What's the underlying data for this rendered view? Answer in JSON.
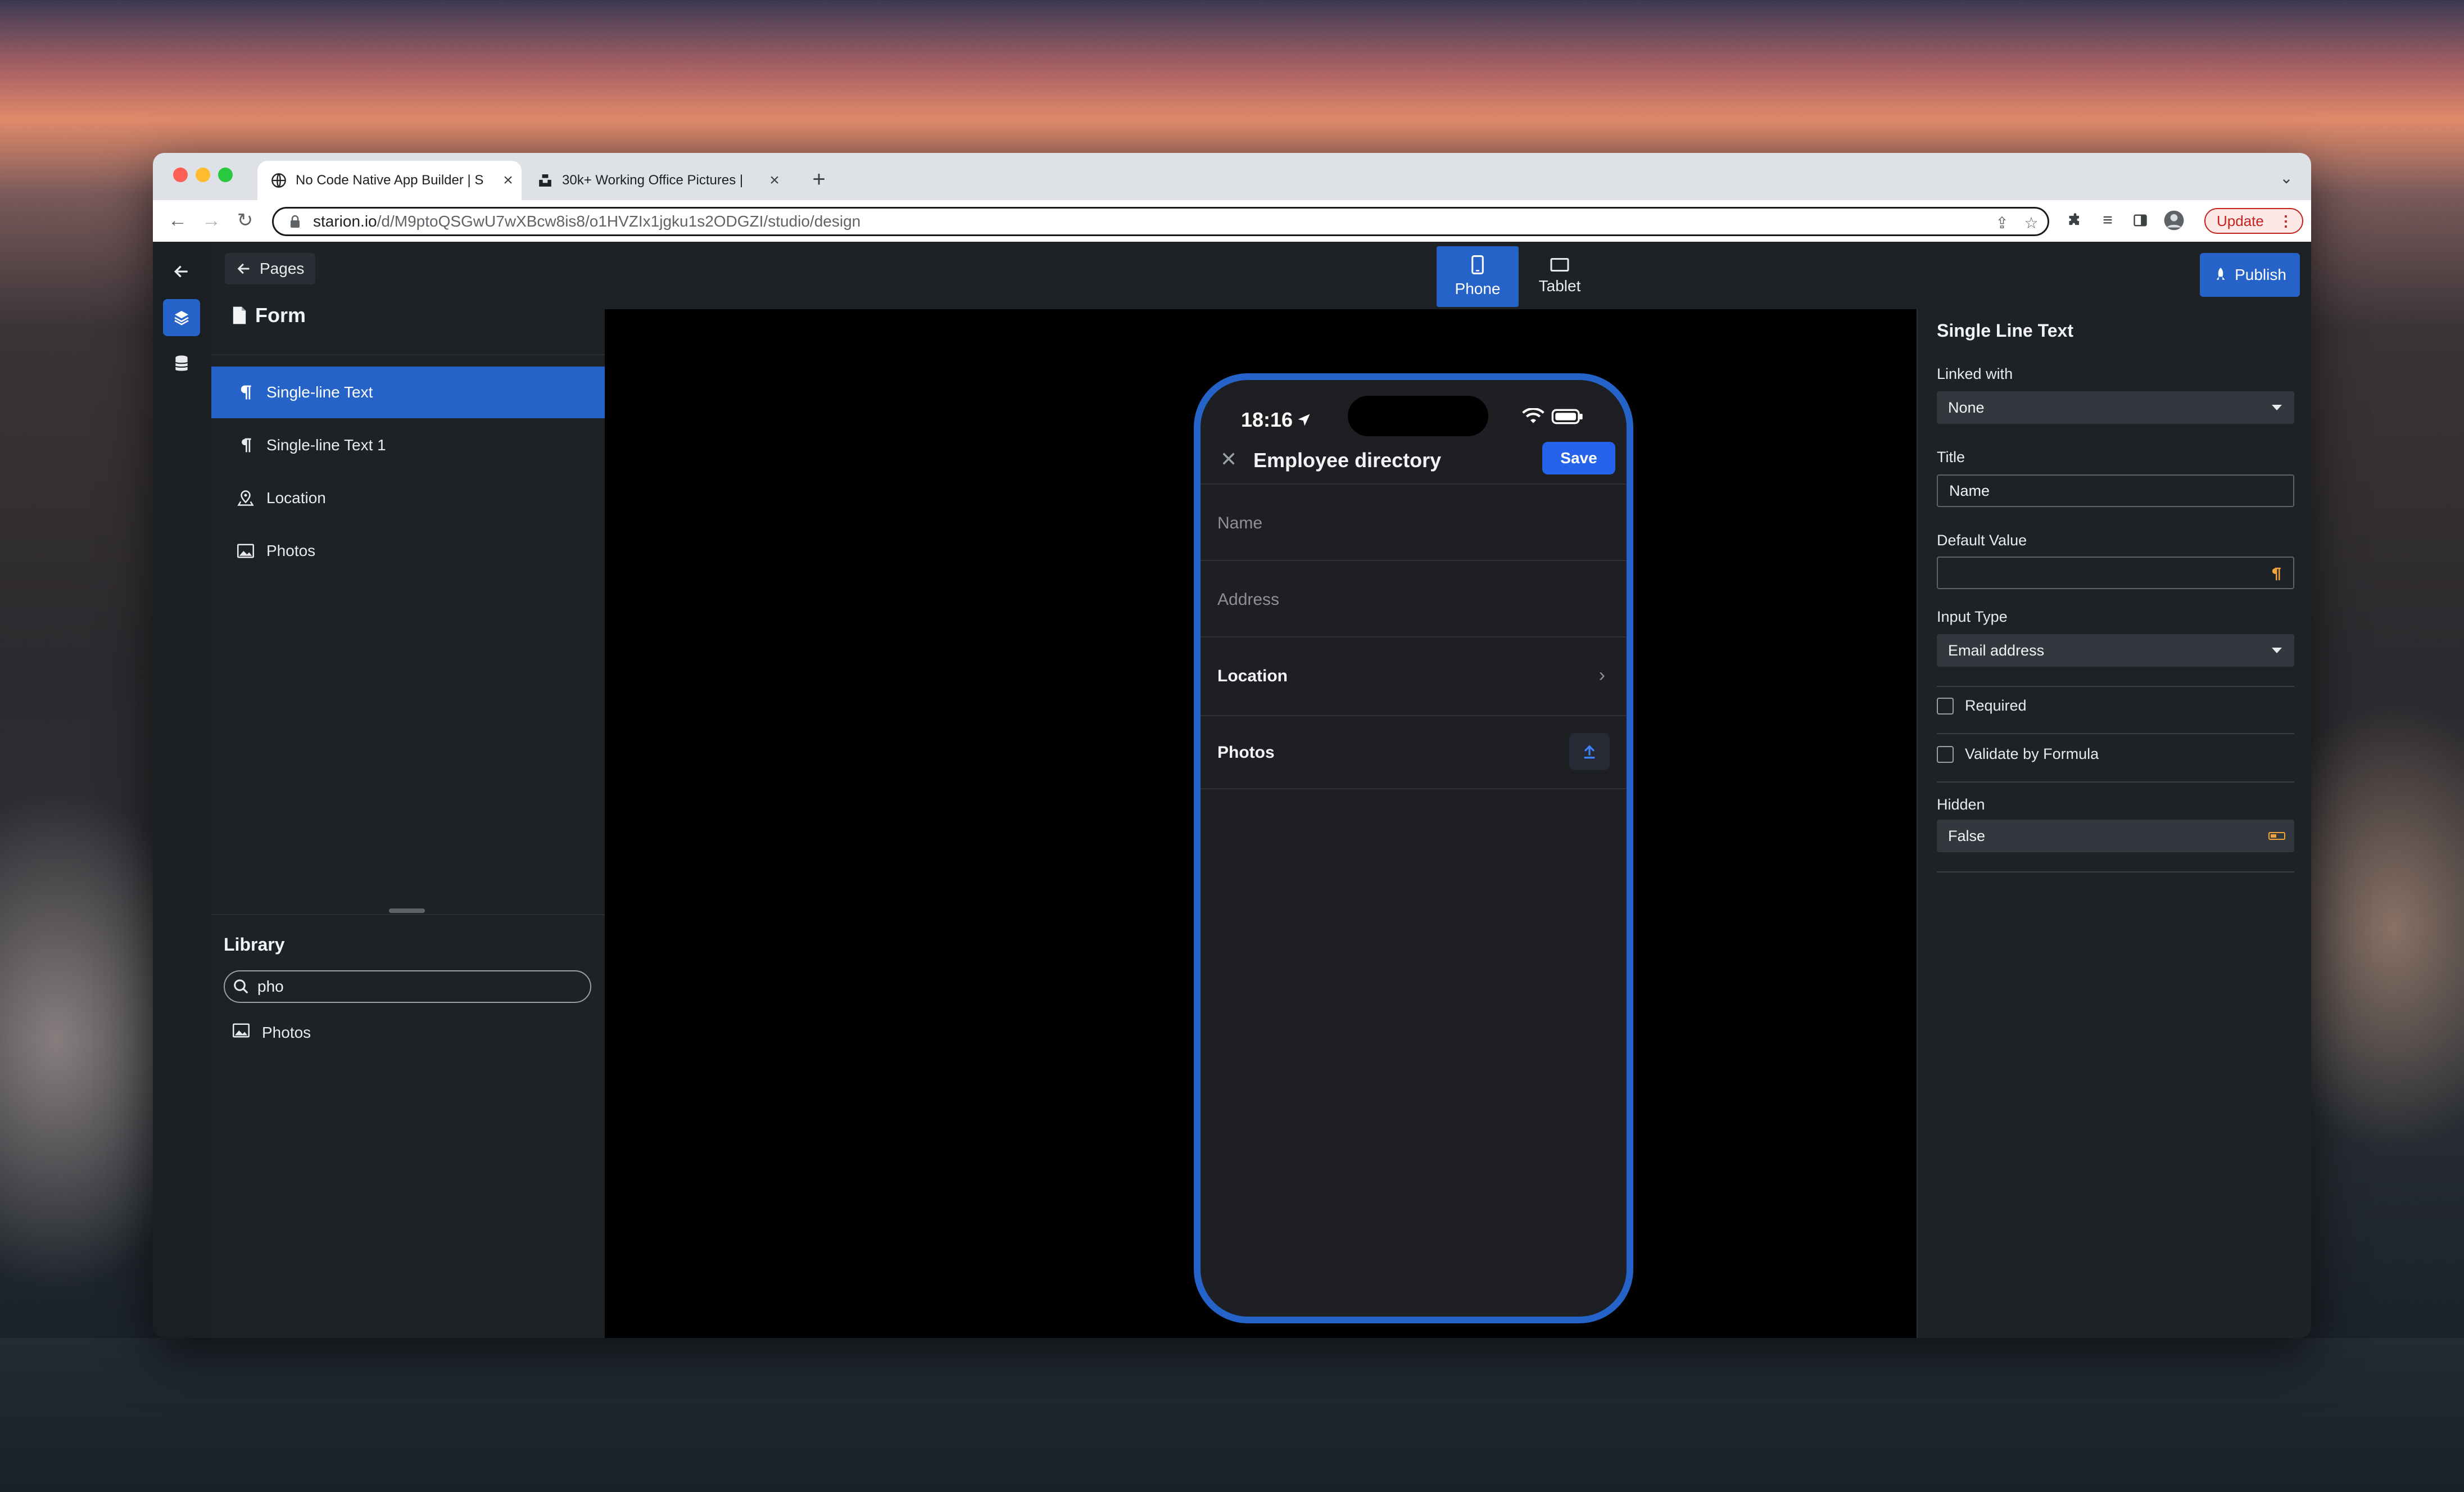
{
  "browser": {
    "tabs": [
      {
        "title": "No Code Native App Builder | S",
        "icon": "globe-icon",
        "active": true
      },
      {
        "title": "30k+ Working Office Pictures | ",
        "icon": "unsplash-icon",
        "active": false
      }
    ],
    "url_host": "starion.io",
    "url_path": "/d/M9ptoQSGwU7wXBcw8is8/o1HVZIx1jgku1s2ODGZI/studio/design",
    "update_label": "Update",
    "colors": {
      "update": "#c5221f",
      "accent": "#2563c9"
    }
  },
  "left_panel": {
    "pages_button": "Pages",
    "form_title": "Form",
    "items": [
      {
        "label": "Single-line Text",
        "icon": "paragraph-icon",
        "selected": true
      },
      {
        "label": "Single-line Text 1",
        "icon": "paragraph-icon",
        "selected": false
      },
      {
        "label": "Location",
        "icon": "location-pin-icon",
        "selected": false
      },
      {
        "label": "Photos",
        "icon": "image-icon",
        "selected": false
      }
    ],
    "library": {
      "title": "Library",
      "search_value": "pho",
      "results": [
        {
          "label": "Photos",
          "icon": "image-icon"
        }
      ]
    }
  },
  "device_switcher": {
    "options": [
      {
        "label": "Phone",
        "icon": "phone-icon",
        "active": true
      },
      {
        "label": "Tablet",
        "icon": "tablet-icon",
        "active": false
      }
    ]
  },
  "publish_label": "Publish",
  "phone": {
    "time": "18:16",
    "title": "Employee directory",
    "save_label": "Save",
    "fields": [
      {
        "label": "Name",
        "kind": "placeholder"
      },
      {
        "label": "Address",
        "kind": "placeholder"
      },
      {
        "label": "Location",
        "kind": "nav"
      },
      {
        "label": "Photos",
        "kind": "upload"
      }
    ]
  },
  "properties": {
    "title": "Single Line Text",
    "linked_with": {
      "label": "Linked with",
      "value": "None"
    },
    "title_field": {
      "label": "Title",
      "value": "Name"
    },
    "default_value": {
      "label": "Default Value",
      "value": ""
    },
    "input_type": {
      "label": "Input Type",
      "value": "Email address"
    },
    "required_label": "Required",
    "validate_label": "Validate by Formula",
    "hidden": {
      "label": "Hidden",
      "value": "False"
    }
  }
}
